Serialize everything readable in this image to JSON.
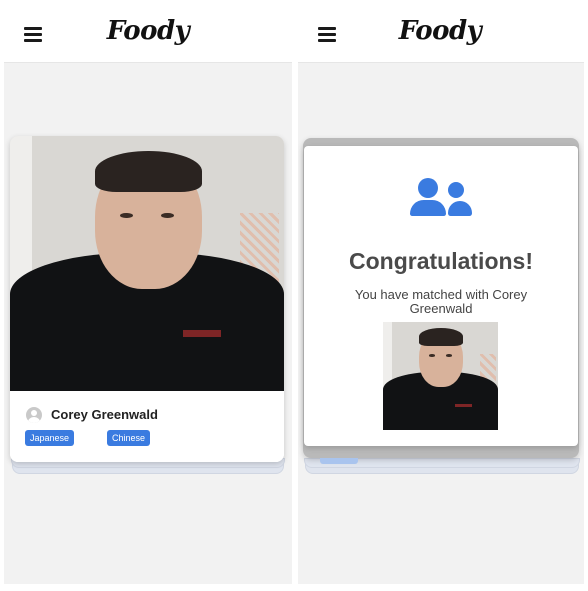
{
  "app": {
    "logo": "Foody"
  },
  "left_screen": {
    "profile": {
      "name": "Corey Greenwald",
      "tags": [
        "Japanese",
        "Chinese"
      ]
    }
  },
  "right_screen": {
    "modal": {
      "title": "Congratulations!",
      "message": "You have matched with Corey Greenwald"
    }
  },
  "icons": {
    "menu": "hamburger-menu-icon",
    "avatar": "user-avatar-icon",
    "match": "two-people-icon"
  },
  "colors": {
    "accent": "#3a7be0",
    "background": "#f2f2f2",
    "text": "#222222"
  }
}
